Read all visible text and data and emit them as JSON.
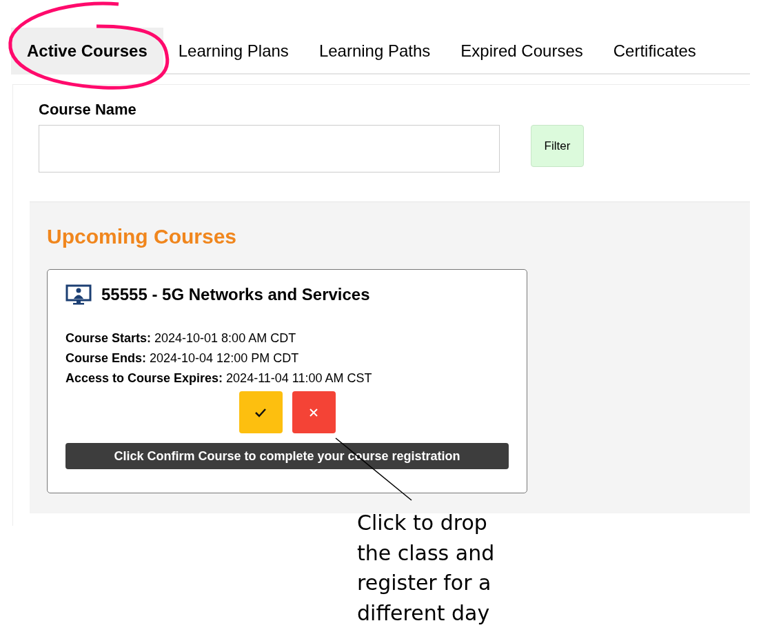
{
  "tabs": [
    {
      "label": "Active Courses",
      "selected": true
    },
    {
      "label": "Learning Plans",
      "selected": false
    },
    {
      "label": "Learning Paths",
      "selected": false
    },
    {
      "label": "Expired Courses",
      "selected": false
    },
    {
      "label": "Certificates",
      "selected": false
    }
  ],
  "filter": {
    "label": "Course Name",
    "button": "Filter"
  },
  "section": {
    "title": "Upcoming Courses",
    "course": {
      "title": "55555 - 5G Networks and Services",
      "details": [
        "**Course Starts:** 2024-10-01 8:00 AM CDT",
        "**Course Ends:** 2024-10-04 12:00 PM CDT",
        "**Access to Course Expires:** 2024-11-04 11:00 AM CST"
      ],
      "notice": "Click Confirm Course to complete your course registration"
    }
  },
  "annotation": {
    "lines": [
      "Click to drop",
      "the class and",
      "register for a",
      "different day"
    ]
  }
}
